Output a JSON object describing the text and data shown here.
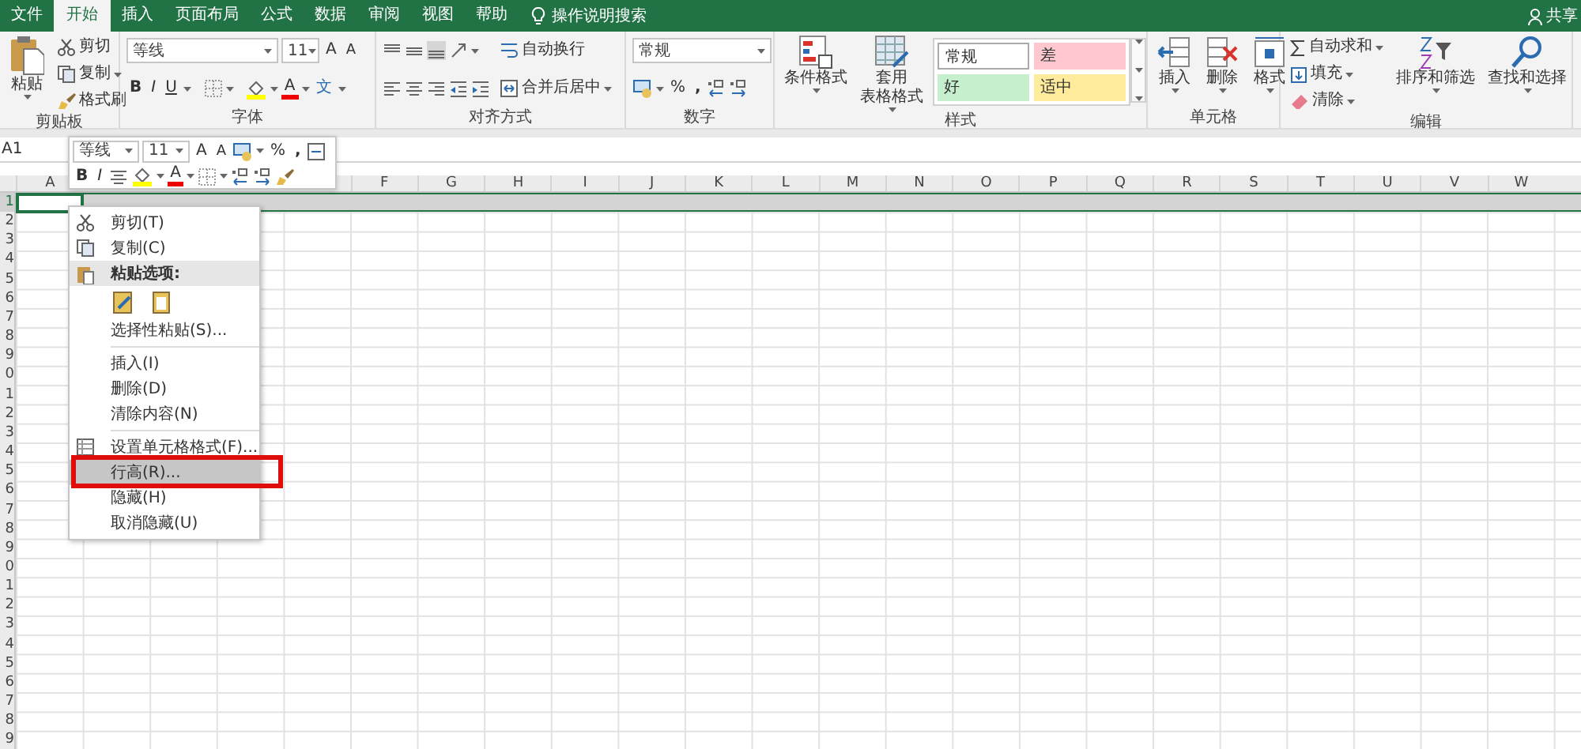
{
  "tabs": [
    {
      "label": "文件",
      "selected": false
    },
    {
      "label": "开始",
      "selected": true
    },
    {
      "label": "插入",
      "selected": false
    },
    {
      "label": "页面布局",
      "selected": false
    },
    {
      "label": "公式",
      "selected": false
    },
    {
      "label": "数据",
      "selected": false
    },
    {
      "label": "审阅",
      "selected": false
    },
    {
      "label": "视图",
      "selected": false
    },
    {
      "label": "帮助",
      "selected": false
    }
  ],
  "tell_me": "操作说明搜索",
  "share": "共享",
  "ribbon": {
    "groups": [
      {
        "kind": "clipboard",
        "label": "剪贴板",
        "big": "粘贴",
        "items": [
          {
            "label": "剪切",
            "dropdown": false
          },
          {
            "label": "复制",
            "dropdown": true
          },
          {
            "label": "格式刷",
            "dropdown": false
          }
        ]
      },
      {
        "kind": "font",
        "label": "字体",
        "font_name": "等线",
        "font_size": "11",
        "grow": "A",
        "shrink": "A",
        "bold": "B",
        "italic": "I",
        "underline": "U",
        "font_color": "A",
        "phonetic": "文"
      },
      {
        "kind": "align",
        "label": "对齐方式",
        "items": [
          {
            "label": "自动换行",
            "dropdown": false
          },
          {
            "label": "合并后居中",
            "dropdown": true
          }
        ]
      },
      {
        "kind": "number",
        "label": "数字",
        "format": "常规",
        "percent": "%",
        "comma": ","
      },
      {
        "kind": "styles",
        "label": "样式",
        "buttons": [
          {
            "lines": [
              "条件格式"
            ]
          },
          {
            "lines": [
              "套用",
              "表格格式"
            ]
          }
        ],
        "gallery": [
          {
            "label": "常规",
            "color": "#ffffff"
          },
          {
            "label": "差",
            "color": "#ffc7ce"
          },
          {
            "label": "好",
            "color": "#c6efce"
          },
          {
            "label": "适中",
            "color": "#ffeb9c"
          }
        ]
      },
      {
        "kind": "cells",
        "label": "单元格",
        "buttons": [
          {
            "label": "插入"
          },
          {
            "label": "删除"
          },
          {
            "label": "格式"
          }
        ]
      },
      {
        "kind": "editing",
        "label": "编辑",
        "items": [
          {
            "label": "自动求和"
          },
          {
            "label": "填充"
          },
          {
            "label": "清除"
          }
        ],
        "buttons": [
          {
            "label": "排序和筛选"
          },
          {
            "label": "查找和选择"
          }
        ]
      }
    ]
  },
  "name_box": "A1",
  "mini_toolbar": {
    "font_name": "等线",
    "font_size": "11",
    "grow": "A",
    "shrink": "A",
    "percent": "%",
    "comma": ",",
    "bold": "B",
    "italic": "I",
    "font_color": "A"
  },
  "grid": {
    "columns": [
      {
        "label": "A"
      },
      {
        "label": "F"
      },
      {
        "label": "G"
      },
      {
        "label": "H"
      },
      {
        "label": "I"
      },
      {
        "label": "J"
      },
      {
        "label": "K"
      },
      {
        "label": "L"
      },
      {
        "label": "M"
      },
      {
        "label": "N"
      },
      {
        "label": "O"
      },
      {
        "label": "P"
      },
      {
        "label": "Q"
      },
      {
        "label": "R"
      },
      {
        "label": "S"
      },
      {
        "label": "T"
      },
      {
        "label": "U"
      },
      {
        "label": "V"
      },
      {
        "label": "W"
      }
    ],
    "rows": [
      {
        "label": "1",
        "selected": true
      },
      {
        "label": "2",
        "selected": false
      },
      {
        "label": "3",
        "selected": false
      },
      {
        "label": "4",
        "selected": false
      },
      {
        "label": "5",
        "selected": false
      },
      {
        "label": "6",
        "selected": false
      },
      {
        "label": "7",
        "selected": false
      },
      {
        "label": "8",
        "selected": false
      },
      {
        "label": "9",
        "selected": false
      },
      {
        "label": "0",
        "selected": false
      },
      {
        "label": "1",
        "selected": false
      },
      {
        "label": "2",
        "selected": false
      },
      {
        "label": "3",
        "selected": false
      },
      {
        "label": "4",
        "selected": false
      },
      {
        "label": "5",
        "selected": false
      },
      {
        "label": "6",
        "selected": false
      },
      {
        "label": "7",
        "selected": false
      },
      {
        "label": "8",
        "selected": false
      },
      {
        "label": "9",
        "selected": false
      },
      {
        "label": "0",
        "selected": false
      },
      {
        "label": "1",
        "selected": false
      },
      {
        "label": "2",
        "selected": false
      },
      {
        "label": "3",
        "selected": false
      },
      {
        "label": "4",
        "selected": false
      },
      {
        "label": "5",
        "selected": false
      },
      {
        "label": "6",
        "selected": false
      },
      {
        "label": "7",
        "selected": false
      },
      {
        "label": "8",
        "selected": false
      },
      {
        "label": "9",
        "selected": false
      }
    ]
  },
  "context_menu": {
    "items": [
      {
        "kind": "cut",
        "label": "剪切(T)",
        "selected": false,
        "annotated": false
      },
      {
        "kind": "copy",
        "label": "复制(C)",
        "selected": false,
        "annotated": false
      },
      {
        "kind": "header",
        "label": "粘贴选项:"
      },
      {
        "kind": "pastes"
      },
      {
        "kind": "item",
        "label": "选择性粘贴(S)...",
        "selected": false,
        "annotated": false
      },
      {
        "kind": "separator"
      },
      {
        "kind": "item",
        "label": "插入(I)",
        "selected": false,
        "annotated": false
      },
      {
        "kind": "item",
        "label": "删除(D)",
        "selected": false,
        "annotated": false
      },
      {
        "kind": "item",
        "label": "清除内容(N)",
        "selected": false,
        "annotated": false
      },
      {
        "kind": "separator"
      },
      {
        "kind": "format",
        "label": "设置单元格格式(F)...",
        "selected": false,
        "annotated": false
      },
      {
        "kind": "item",
        "label": "行高(R)...",
        "selected": true,
        "annotated": true
      },
      {
        "kind": "item",
        "label": "隐藏(H)",
        "selected": false,
        "annotated": false
      },
      {
        "kind": "item",
        "label": "取消隐藏(U)",
        "selected": false,
        "annotated": false
      }
    ]
  }
}
